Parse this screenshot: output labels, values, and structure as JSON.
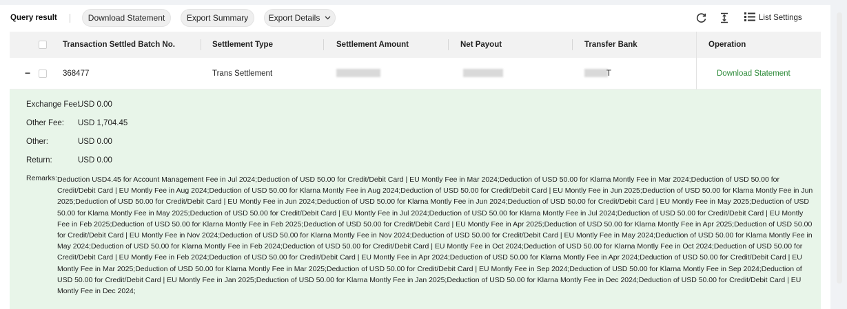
{
  "toolbar": {
    "title": "Query result",
    "download_statement": "Download Statement",
    "export_summary": "Export Summary",
    "export_details": "Export Details",
    "list_settings": "List Settings"
  },
  "icons": {
    "refresh": "refresh-icon",
    "density": "row-height-icon",
    "list_settings": "list-settings-icon",
    "expand_toggle": "collapse-minus-icon"
  },
  "table": {
    "headers": [
      "Transaction Settled Batch No.",
      "Settlement Type",
      "Settlement Amount",
      "Net Payout",
      "Transfer Bank",
      "Operation"
    ],
    "row": {
      "batch_no": "368477",
      "settlement_type": "Trans Settlement",
      "transfer_bank_partial": "T",
      "operation": "Download Statement",
      "expand_symbol": "−"
    }
  },
  "details": {
    "exchange_fee_label": "Exchange Fee:",
    "exchange_fee_value": "USD 0.00",
    "other_fee_label": "Other Fee:",
    "other_fee_value": "USD 1,704.45",
    "other_label": "Other:",
    "other_value": "USD 0.00",
    "return_label": "Return:",
    "return_value": "USD 0.00",
    "remarks_label": "Remarks:",
    "remarks_text": "Deduction USD4.45 for Account Management Fee in Jul 2024;Deduction of USD 50.00 for Credit/Debit Card | EU Montly Fee in Mar 2024;Deduction of USD 50.00 for Klarna Montly Fee in Mar 2024;Deduction of USD 50.00 for Credit/Debit Card | EU Montly Fee in Aug 2024;Deduction of USD 50.00 for Klarna Montly Fee in Aug 2024;Deduction of USD 50.00 for Credit/Debit Card | EU Montly Fee in Jun 2025;Deduction of USD 50.00 for Klarna Montly Fee in Jun 2025;Deduction of USD 50.00 for Credit/Debit Card | EU Montly Fee in Jun 2024;Deduction of USD 50.00 for Klarna Montly Fee in Jun 2024;Deduction of USD 50.00 for Credit/Debit Card | EU Montly Fee in May 2025;Deduction of USD 50.00 for Klarna Montly Fee in May 2025;Deduction of USD 50.00 for Credit/Debit Card | EU Montly Fee in Jul 2024;Deduction of USD 50.00 for Klarna Montly Fee in Jul 2024;Deduction of USD 50.00 for Credit/Debit Card | EU Montly Fee in Feb 2025;Deduction of USD 50.00 for Klarna Montly Fee in Feb 2025;Deduction of USD 50.00 for Credit/Debit Card | EU Montly Fee in Apr 2025;Deduction of USD 50.00 for Klarna Montly Fee in Apr 2025;Deduction of USD 50.00 for Credit/Debit Card | EU Montly Fee in Nov 2024;Deduction of USD 50.00 for Klarna Montly Fee in Nov 2024;Deduction of USD 50.00 for Credit/Debit Card | EU Montly Fee in May 2024;Deduction of USD 50.00 for Klarna Montly Fee in May 2024;Deduction of USD 50.00 for Klarna Montly Fee in Feb 2024;Deduction of USD 50.00 for Credit/Debit Card | EU Montly Fee in Oct 2024;Deduction of USD 50.00 for Klarna Montly Fee in Oct 2024;Deduction of USD 50.00 for Credit/Debit Card | EU Montly Fee in Feb 2024;Deduction of USD 50.00 for Credit/Debit Card | EU Montly Fee in Apr 2024;Deduction of USD 50.00 for Klarna Montly Fee in Apr 2024;Deduction of USD 50.00 for Credit/Debit Card | EU Montly Fee in Mar 2025;Deduction of USD 50.00 for Klarna Montly Fee in Mar 2025;Deduction of USD 50.00 for Credit/Debit Card | EU Montly Fee in Sep 2024;Deduction of USD 50.00 for Klarna Montly Fee in Sep 2024;Deduction of USD 50.00 for Credit/Debit Card | EU Montly Fee in Jan 2025;Deduction of USD 50.00 for Klarna Montly Fee in Jan 2025;Deduction of USD 50.00 for Klarna Montly Fee in Dec 2024;Deduction of USD 50.00 for Credit/Debit Card | EU Montly Fee in Dec 2024;"
  },
  "colors": {
    "link_green": "#2e8b3a",
    "detail_bg": "#e8f5e9",
    "header_bg": "#f2f2f2"
  }
}
